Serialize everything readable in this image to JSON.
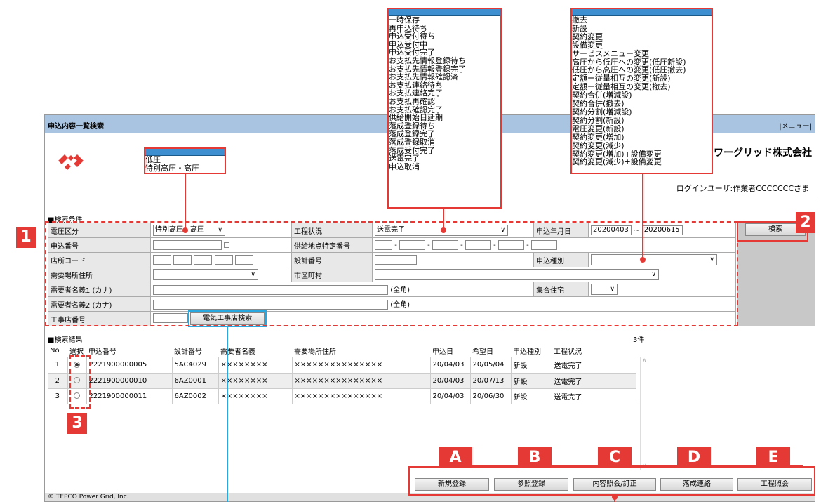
{
  "window": {
    "title": "申込内容一覧検索",
    "menu_label": "|メニュー|",
    "company": "ワーグリッド株式会社",
    "user_line": "ログインユーザ:作業者CCCCCCCさま",
    "footer": "© TEPCO Power Grid, Inc."
  },
  "search": {
    "section_title": "■検索条件",
    "labels": {
      "voltage": "電圧区分",
      "status": "工程状況",
      "date": "申込年月日",
      "app_no": "申込番号",
      "supply_no": "供給地点特定番号",
      "shop_code": "店所コード",
      "design_no": "設計番号",
      "app_type": "申込種別",
      "address": "需要場所住所",
      "city": "市区町村",
      "name1": "需要者名義1 (カナ)",
      "name2": "需要者名義2 (カナ)",
      "complex": "集合住宅",
      "contractor": "工事店番号"
    },
    "voltage_value": "特別高圧・高圧",
    "status_value": "送電完了",
    "date_from": "20200403",
    "date_sep": "~",
    "date_to": "20200615",
    "fullwidth": "(全角)",
    "dash": "-",
    "contractor_button": "電気工事店検索",
    "search_button": "検索"
  },
  "results": {
    "section_title": "■検索結果",
    "count": "3件",
    "headers": [
      "No",
      "選択",
      "申込番号",
      "設計番号",
      "需要者名義",
      "需要場所住所",
      "申込日",
      "希望日",
      "申込種別",
      "工程状況"
    ],
    "rows": [
      {
        "no": "1",
        "app_no": "2221900000005",
        "design_no": "5AC4029",
        "name": "××××××××",
        "address": "×××××××××××××××",
        "app_date": "20/04/03",
        "wish_date": "20/05/04",
        "type": "新設",
        "status": "送電完了"
      },
      {
        "no": "2",
        "app_no": "2221900000010",
        "design_no": "6AZ0001",
        "name": "××××××××",
        "address": "×××××××××××××××",
        "app_date": "20/04/03",
        "wish_date": "20/07/13",
        "type": "新設",
        "status": "送電完了"
      },
      {
        "no": "3",
        "app_no": "2221900000011",
        "design_no": "6AZ0002",
        "name": "××××××××",
        "address": "×××××××××××××××",
        "app_date": "20/04/03",
        "wish_date": "20/06/30",
        "type": "新設",
        "status": "送電完了"
      }
    ]
  },
  "actions": [
    "新規登録",
    "参照登録",
    "内容照会/訂正",
    "落成連絡",
    "工程照会"
  ],
  "callouts": {
    "voltage_options": [
      "低圧",
      "特別高圧・高圧"
    ],
    "status_options": [
      "一時保存",
      "再申込待ち",
      "申込受付待ち",
      "申込受付中",
      "申込受付完了",
      "お支払先情報登録待ち",
      "お支払先情報登録完了",
      "お支払先情報確認済",
      "お支払連絡待ち",
      "お支払連絡完了",
      "お支払再確認",
      "お支払確認完了",
      "供給開始日延期",
      "落成登録待ち",
      "落成登録完了",
      "落成登録取消",
      "落成受付完了",
      "送電完了",
      "申込取消"
    ],
    "type_options": [
      "撤去",
      "新設",
      "契約変更",
      "設備変更",
      "サービスメニュー変更",
      "高圧から低圧への変更(低圧新設)",
      "低圧から高圧への変更(低圧撤去)",
      "定額ー従量相互の変更(新設)",
      "定額ー従量相互の変更(撤去)",
      "契約合併(増減設)",
      "契約合併(撤去)",
      "契約分割(増減設)",
      "契約分割(新設)",
      "電圧変更(新設)",
      "契約変更(増加)",
      "契約変更(減少)",
      "契約変更(増加)+設備変更",
      "契約変更(減少)+設備変更"
    ],
    "badges": [
      "1",
      "2",
      "3",
      "A",
      "B",
      "C",
      "D",
      "E"
    ]
  },
  "colors": {
    "accent": "#e53935",
    "title_bar": "#a9c4e0",
    "highlight_blue": "#29a8e0"
  }
}
